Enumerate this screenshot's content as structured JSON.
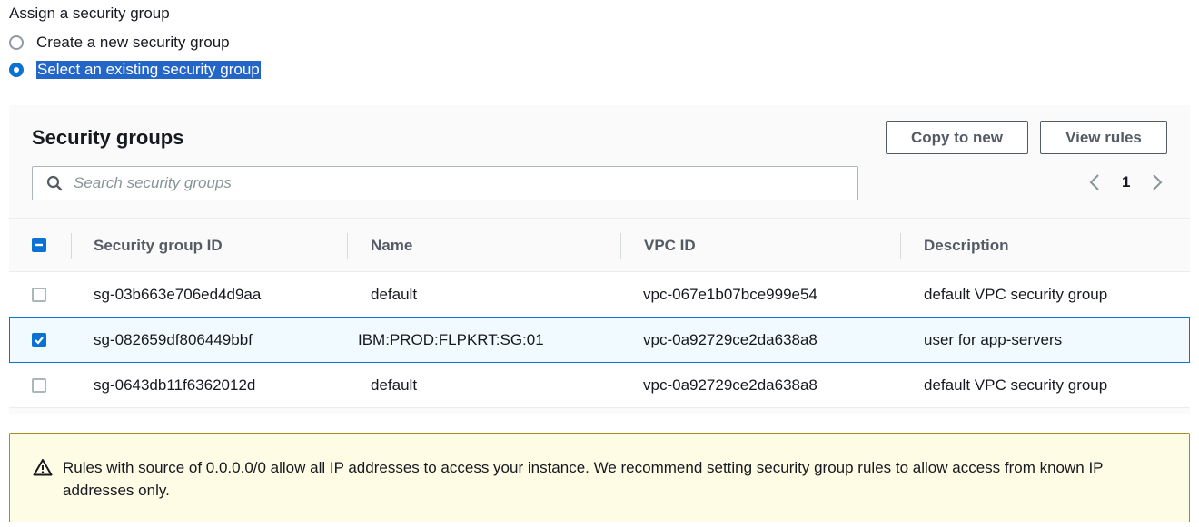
{
  "assign": {
    "heading": "Assign a security group",
    "options": [
      {
        "label": "Create a new security group",
        "checked": false
      },
      {
        "label": "Select an existing security group",
        "checked": true
      }
    ]
  },
  "panel": {
    "title": "Security groups",
    "copy_button": "Copy to new",
    "view_button": "View rules",
    "search_placeholder": "Search security groups",
    "page": "1"
  },
  "table": {
    "columns": [
      "Security group ID",
      "Name",
      "VPC ID",
      "Description"
    ],
    "rows": [
      {
        "id": "sg-03b663e706ed4d9aa",
        "name": "default",
        "vpc": "vpc-067e1b07bce999e54",
        "desc": "default VPC security group",
        "checked": false
      },
      {
        "id": "sg-082659df806449bbf",
        "name": "IBM:PROD:FLPKRT:SG:01",
        "vpc": "vpc-0a92729ce2da638a8",
        "desc": "user for app-servers",
        "checked": true
      },
      {
        "id": "sg-0643db11f6362012d",
        "name": "default",
        "vpc": "vpc-0a92729ce2da638a8",
        "desc": "default VPC security group",
        "checked": false
      }
    ]
  },
  "warning": {
    "text": "Rules with source of 0.0.0.0/0 allow all IP addresses to access your instance. We recommend setting security group rules to allow access from known IP addresses only."
  },
  "colors": {
    "accent": "#0972d3",
    "warning_bg": "#fffce6",
    "warning_border": "#ad8a1f"
  }
}
